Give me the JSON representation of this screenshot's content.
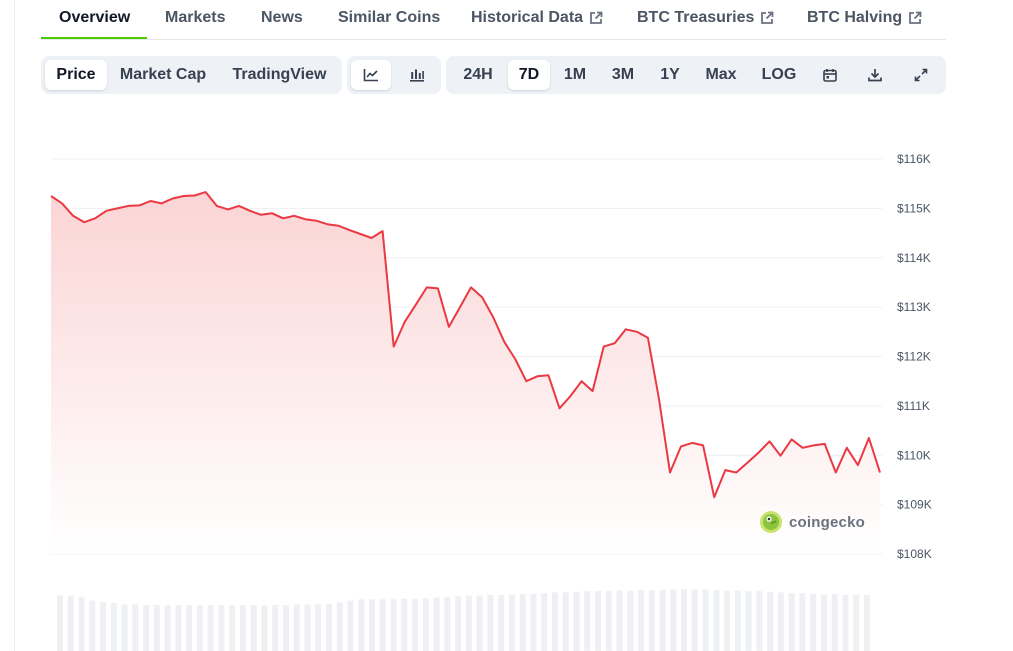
{
  "tabs": [
    {
      "label": "Overview",
      "active": true,
      "external": false
    },
    {
      "label": "Markets",
      "active": false,
      "external": false
    },
    {
      "label": "News",
      "active": false,
      "external": false
    },
    {
      "label": "Similar Coins",
      "active": false,
      "external": false
    },
    {
      "label": "Historical Data",
      "active": false,
      "external": true
    },
    {
      "label": "BTC Treasuries",
      "active": false,
      "external": true
    },
    {
      "label": "BTC Halving",
      "active": false,
      "external": true
    }
  ],
  "chart_type_toggle": {
    "options": [
      "Price",
      "Market Cap",
      "TradingView"
    ],
    "selected": "Price"
  },
  "chart_style_toggle": {
    "options": [
      "line-chart-icon",
      "candlestick-chart-icon"
    ],
    "selected": "line-chart-icon"
  },
  "range_toggle": {
    "options": [
      "24H",
      "7D",
      "1M",
      "3M",
      "1Y",
      "Max",
      "LOG"
    ],
    "selected": "7D"
  },
  "tool_icons": [
    "calendar-icon",
    "download-icon",
    "fullscreen-icon"
  ],
  "watermark": "coingecko",
  "colors": {
    "accent_green": "#4bcc00",
    "line_red": "#ea3943",
    "area_fill": "#fde2e2"
  },
  "chart_data": {
    "type": "area",
    "title": "",
    "xlabel": "",
    "ylabel": "",
    "y_tick_labels": [
      "$116K",
      "$115K",
      "$114K",
      "$113K",
      "$112K",
      "$111K",
      "$110K",
      "$109K",
      "$108K"
    ],
    "y_ticks": [
      116000,
      115000,
      114000,
      113000,
      112000,
      111000,
      110000,
      109000,
      108000
    ],
    "ylim": [
      108000,
      116000
    ],
    "grid": true,
    "series": [
      {
        "values": [
          115250,
          115100,
          114850,
          114720,
          114800,
          114950,
          115000,
          115050,
          115060,
          115150,
          115100,
          115200,
          115250,
          115260,
          115330,
          115050,
          114980,
          115050,
          114950,
          114870,
          114900,
          114800,
          114850,
          114780,
          114750,
          114680,
          114650,
          114560,
          114480,
          114400,
          114540,
          112200,
          112700,
          113050,
          113400,
          113380,
          112600,
          113000,
          113400,
          113200,
          112800,
          112300,
          111950,
          111500,
          111600,
          111620,
          110950,
          111200,
          111500,
          111300,
          112200,
          112270,
          112550,
          112500,
          112380,
          111150,
          109650,
          110180,
          110250,
          110200,
          109150,
          109700,
          109650,
          109850,
          110050,
          110280,
          109990,
          110320,
          110150,
          110200,
          110230,
          109650,
          110150,
          109800,
          110350,
          109650
        ]
      }
    ],
    "volume": [
      0.88,
      0.88,
      0.86,
      0.8,
      0.78,
      0.76,
      0.74,
      0.74,
      0.73,
      0.73,
      0.73,
      0.73,
      0.73,
      0.73,
      0.73,
      0.73,
      0.73,
      0.73,
      0.73,
      0.73,
      0.73,
      0.73,
      0.74,
      0.74,
      0.74,
      0.75,
      0.77,
      0.8,
      0.82,
      0.82,
      0.82,
      0.82,
      0.83,
      0.83,
      0.84,
      0.85,
      0.86,
      0.87,
      0.88,
      0.88,
      0.89,
      0.89,
      0.9,
      0.9,
      0.91,
      0.92,
      0.93,
      0.93,
      0.94,
      0.95,
      0.95,
      0.95,
      0.96,
      0.96,
      0.97,
      0.97,
      0.97,
      0.98,
      0.98,
      0.98,
      0.98,
      0.97,
      0.96,
      0.96,
      0.95,
      0.95,
      0.94,
      0.93,
      0.92,
      0.92,
      0.91,
      0.9,
      0.9,
      0.89,
      0.89,
      0.89
    ]
  }
}
